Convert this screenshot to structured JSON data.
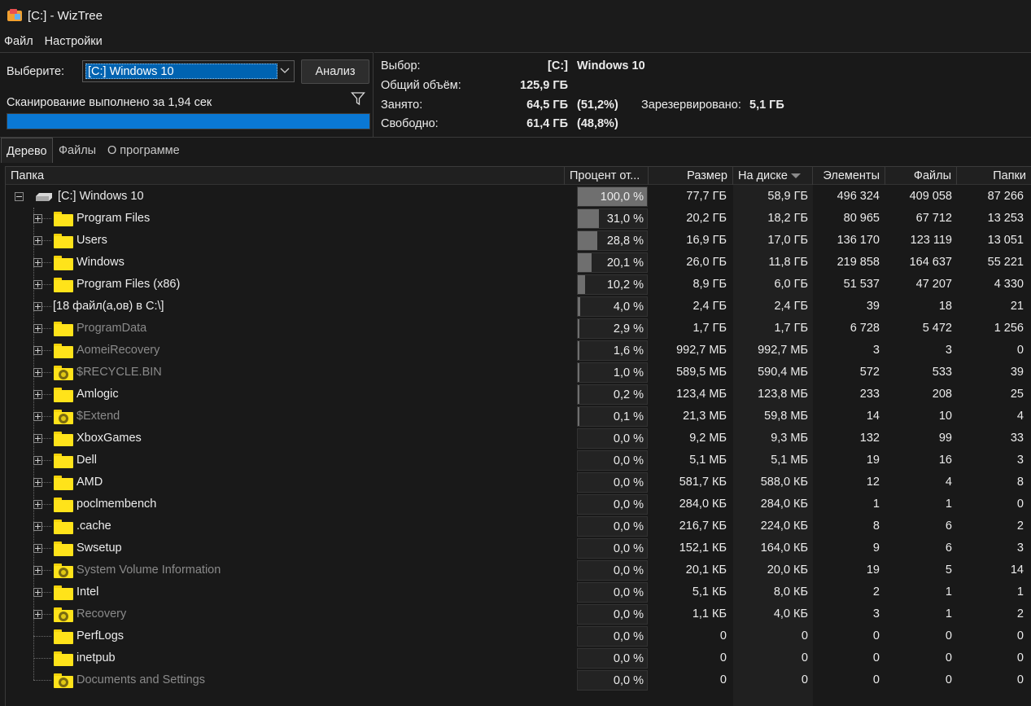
{
  "window": {
    "title": "[C:]  - WizTree"
  },
  "menu": {
    "items": [
      "Файл",
      "Настройки"
    ]
  },
  "scan": {
    "select_label": "Выберите:",
    "drive_value": "[C:] Windows 10",
    "analyze_label": "Анализ",
    "status_text": "Сканирование выполнено за 1,94 сек",
    "progress": 1.0
  },
  "info": {
    "selection_label": "Выбор:",
    "selection_drive": "[C:]",
    "selection_name": "Windows 10",
    "total_label": "Общий объём:",
    "total_value": "125,9 ГБ",
    "used_label": "Занято:",
    "used_value": "64,5 ГБ",
    "used_pct": "(51,2%)",
    "reserved_label": "Зарезервировано:",
    "reserved_value": "5,1 ГБ",
    "free_label": "Свободно:",
    "free_value": "61,4 ГБ",
    "free_pct": "(48,8%)"
  },
  "tabs": [
    "Дерево",
    "Файлы",
    "О программе"
  ],
  "columns": [
    "Папка",
    "Процент от...",
    "Размер",
    "На диске",
    "Элементы",
    "Файлы",
    "Папки"
  ],
  "rows": [
    {
      "name": "[C:] Windows 10",
      "pct": "100,0 %",
      "pct_fill": 1.0,
      "size": "77,7 ГБ",
      "disk": "58,9 ГБ",
      "items": "496 324",
      "files": "409 058",
      "folders": "87 266",
      "kind": "drive",
      "hidden": false
    },
    {
      "name": "Program Files",
      "pct": "31,0 %",
      "pct_fill": 0.31,
      "size": "20,2 ГБ",
      "disk": "18,2 ГБ",
      "items": "80 965",
      "files": "67 712",
      "folders": "13 253",
      "kind": "folder",
      "hidden": false
    },
    {
      "name": "Users",
      "pct": "28,8 %",
      "pct_fill": 0.288,
      "size": "16,9 ГБ",
      "disk": "17,0 ГБ",
      "items": "136 170",
      "files": "123 119",
      "folders": "13 051",
      "kind": "folder",
      "hidden": false
    },
    {
      "name": "Windows",
      "pct": "20,1 %",
      "pct_fill": 0.201,
      "size": "26,0 ГБ",
      "disk": "11,8 ГБ",
      "items": "219 858",
      "files": "164 637",
      "folders": "55 221",
      "kind": "folder",
      "hidden": false
    },
    {
      "name": "Program Files (x86)",
      "pct": "10,2 %",
      "pct_fill": 0.102,
      "size": "8,9 ГБ",
      "disk": "6,0 ГБ",
      "items": "51 537",
      "files": "47 207",
      "folders": "4 330",
      "kind": "folder",
      "hidden": false
    },
    {
      "name": "[18 файл(а,ов) в C:\\]",
      "pct": "4,0 %",
      "pct_fill": 0.04,
      "size": "2,4 ГБ",
      "disk": "2,4 ГБ",
      "items": "39",
      "files": "18",
      "folders": "21",
      "kind": "files",
      "hidden": false
    },
    {
      "name": "ProgramData",
      "pct": "2,9 %",
      "pct_fill": 0.029,
      "size": "1,7 ГБ",
      "disk": "1,7 ГБ",
      "items": "6 728",
      "files": "5 472",
      "folders": "1 256",
      "kind": "folder",
      "hidden": true
    },
    {
      "name": "AomeiRecovery",
      "pct": "1,6 %",
      "pct_fill": 0.016,
      "size": "992,7 МБ",
      "disk": "992,7 МБ",
      "items": "3",
      "files": "3",
      "folders": "0",
      "kind": "folder",
      "hidden": true
    },
    {
      "name": "$RECYCLE.BIN",
      "pct": "1,0 %",
      "pct_fill": 0.01,
      "size": "589,5 МБ",
      "disk": "590,4 МБ",
      "items": "572",
      "files": "533",
      "folders": "39",
      "kind": "system",
      "hidden": true
    },
    {
      "name": "Amlogic",
      "pct": "0,2 %",
      "pct_fill": 0.002,
      "size": "123,4 МБ",
      "disk": "123,8 МБ",
      "items": "233",
      "files": "208",
      "folders": "25",
      "kind": "folder",
      "hidden": false
    },
    {
      "name": "$Extend",
      "pct": "0,1 %",
      "pct_fill": 0.001,
      "size": "21,3 МБ",
      "disk": "59,8 МБ",
      "items": "14",
      "files": "10",
      "folders": "4",
      "kind": "system",
      "hidden": true
    },
    {
      "name": "XboxGames",
      "pct": "0,0 %",
      "pct_fill": 0,
      "size": "9,2 МБ",
      "disk": "9,3 МБ",
      "items": "132",
      "files": "99",
      "folders": "33",
      "kind": "folder",
      "hidden": false
    },
    {
      "name": "Dell",
      "pct": "0,0 %",
      "pct_fill": 0,
      "size": "5,1 МБ",
      "disk": "5,1 МБ",
      "items": "19",
      "files": "16",
      "folders": "3",
      "kind": "folder",
      "hidden": false
    },
    {
      "name": "AMD",
      "pct": "0,0 %",
      "pct_fill": 0,
      "size": "581,7 КБ",
      "disk": "588,0 КБ",
      "items": "12",
      "files": "4",
      "folders": "8",
      "kind": "folder",
      "hidden": false
    },
    {
      "name": "poclmembench",
      "pct": "0,0 %",
      "pct_fill": 0,
      "size": "284,0 КБ",
      "disk": "284,0 КБ",
      "items": "1",
      "files": "1",
      "folders": "0",
      "kind": "folder",
      "hidden": false
    },
    {
      "name": ".cache",
      "pct": "0,0 %",
      "pct_fill": 0,
      "size": "216,7 КБ",
      "disk": "224,0 КБ",
      "items": "8",
      "files": "6",
      "folders": "2",
      "kind": "folder",
      "hidden": false
    },
    {
      "name": "Swsetup",
      "pct": "0,0 %",
      "pct_fill": 0,
      "size": "152,1 КБ",
      "disk": "164,0 КБ",
      "items": "9",
      "files": "6",
      "folders": "3",
      "kind": "folder",
      "hidden": false
    },
    {
      "name": "System Volume Information",
      "pct": "0,0 %",
      "pct_fill": 0,
      "size": "20,1 КБ",
      "disk": "20,0 КБ",
      "items": "19",
      "files": "5",
      "folders": "14",
      "kind": "system",
      "hidden": true
    },
    {
      "name": "Intel",
      "pct": "0,0 %",
      "pct_fill": 0,
      "size": "5,1 КБ",
      "disk": "8,0 КБ",
      "items": "2",
      "files": "1",
      "folders": "1",
      "kind": "folder",
      "hidden": false
    },
    {
      "name": "Recovery",
      "pct": "0,0 %",
      "pct_fill": 0,
      "size": "1,1 КБ",
      "disk": "4,0 КБ",
      "items": "3",
      "files": "1",
      "folders": "2",
      "kind": "system",
      "hidden": true
    },
    {
      "name": "PerfLogs",
      "pct": "0,0 %",
      "pct_fill": 0,
      "size": "0",
      "disk": "0",
      "items": "0",
      "files": "0",
      "folders": "0",
      "kind": "folder",
      "hidden": false
    },
    {
      "name": "inetpub",
      "pct": "0,0 %",
      "pct_fill": 0,
      "size": "0",
      "disk": "0",
      "items": "0",
      "files": "0",
      "folders": "0",
      "kind": "folder",
      "hidden": false
    },
    {
      "name": "Documents and Settings",
      "pct": "0,0 %",
      "pct_fill": 0,
      "size": "0",
      "disk": "0",
      "items": "0",
      "files": "0",
      "folders": "0",
      "kind": "system",
      "hidden": true
    }
  ],
  "colors": {
    "accent": "#0a78d4",
    "folder": "#ffe31a",
    "background": "#191919",
    "bar": "#6f6f6f"
  }
}
